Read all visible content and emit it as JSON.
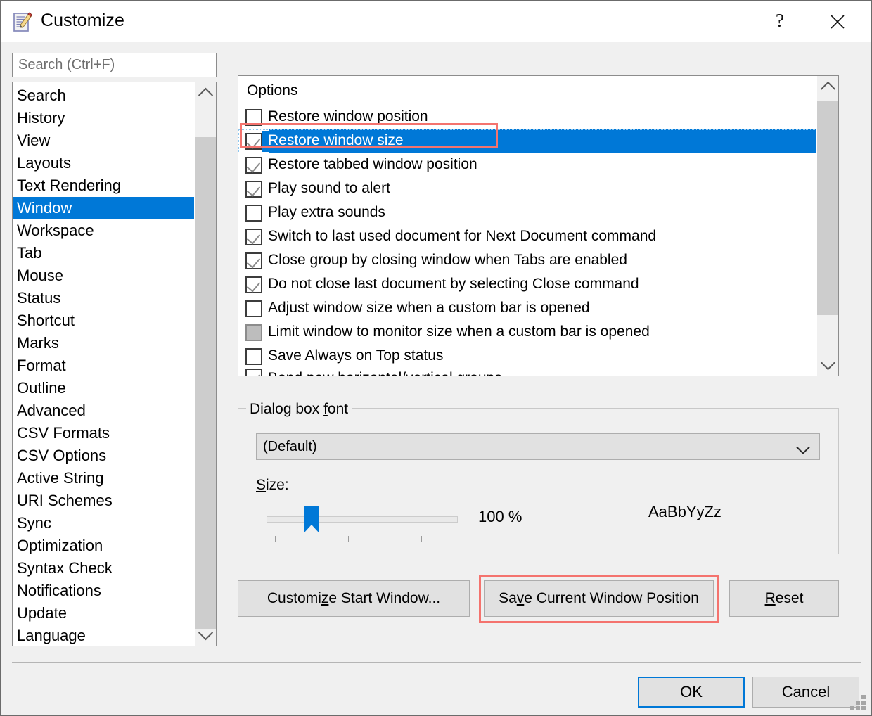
{
  "window": {
    "title": "Customize",
    "icon": "document-pencil-icon",
    "help_label": "?",
    "close_label": "✕"
  },
  "search": {
    "placeholder": "Search (Ctrl+F)",
    "value": ""
  },
  "sidebar": {
    "selected": "Window",
    "items": [
      {
        "label": "Search"
      },
      {
        "label": "History"
      },
      {
        "label": "View"
      },
      {
        "label": "Layouts"
      },
      {
        "label": "Text Rendering"
      },
      {
        "label": "Window"
      },
      {
        "label": "Workspace"
      },
      {
        "label": "Tab"
      },
      {
        "label": "Mouse"
      },
      {
        "label": "Status"
      },
      {
        "label": "Shortcut"
      },
      {
        "label": "Marks"
      },
      {
        "label": "Format"
      },
      {
        "label": "Outline"
      },
      {
        "label": "Advanced"
      },
      {
        "label": "CSV Formats"
      },
      {
        "label": "CSV Options"
      },
      {
        "label": "Active String"
      },
      {
        "label": "URI Schemes"
      },
      {
        "label": "Sync"
      },
      {
        "label": "Optimization"
      },
      {
        "label": "Syntax Check"
      },
      {
        "label": "Notifications"
      },
      {
        "label": "Update"
      },
      {
        "label": "Language"
      }
    ]
  },
  "options": {
    "header": "Options",
    "items": [
      {
        "label": "Restore window position",
        "state": "unchecked",
        "selected": false
      },
      {
        "label": "Restore window size",
        "state": "checked",
        "selected": true
      },
      {
        "label": "Restore tabbed window position",
        "state": "checked",
        "selected": false
      },
      {
        "label": "Play sound to alert",
        "state": "checked",
        "selected": false
      },
      {
        "label": "Play extra sounds",
        "state": "unchecked",
        "selected": false
      },
      {
        "label": "Switch to last used document for Next Document command",
        "state": "checked",
        "selected": false
      },
      {
        "label": "Close group by closing window when Tabs are enabled",
        "state": "checked",
        "selected": false
      },
      {
        "label": "Do not close last document by selecting Close command",
        "state": "checked",
        "selected": false
      },
      {
        "label": "Adjust window size when a custom bar is opened",
        "state": "unchecked",
        "selected": false
      },
      {
        "label": "Limit window to monitor size when a custom bar is opened",
        "state": "disabled",
        "selected": false
      },
      {
        "label": "Save Always on Top status",
        "state": "unchecked",
        "selected": false
      },
      {
        "label": "Bond new horizontal/vertical groups",
        "state": "checked",
        "selected": false
      }
    ]
  },
  "font_group": {
    "legend": "Dialog box font",
    "legend_mnemonic": "f",
    "combo_value": "(Default)",
    "size_label": "Size:",
    "size_label_mnemonic": "S",
    "size_value": "100 %",
    "preview_text": "AaBbYyZz",
    "slider_percent": 100,
    "slider_ticks": 6
  },
  "buttons": {
    "customize_start": {
      "before": "Customi",
      "mnemonic": "z",
      "after": "e Start Window..."
    },
    "save_position": {
      "before": "Sa",
      "mnemonic": "v",
      "after": "e Current Window Position"
    },
    "reset": {
      "before": "",
      "mnemonic": "R",
      "after": "eset"
    },
    "ok": "OK",
    "cancel": "Cancel"
  },
  "colors": {
    "accent": "#0078d7",
    "annotation": "#f4736e",
    "dialog_bg": "#f0f0f0",
    "button_bg": "#e1e1e1"
  },
  "annotations": [
    {
      "name": "highlight-restore-window-size"
    },
    {
      "name": "highlight-save-current-window-position"
    }
  ]
}
